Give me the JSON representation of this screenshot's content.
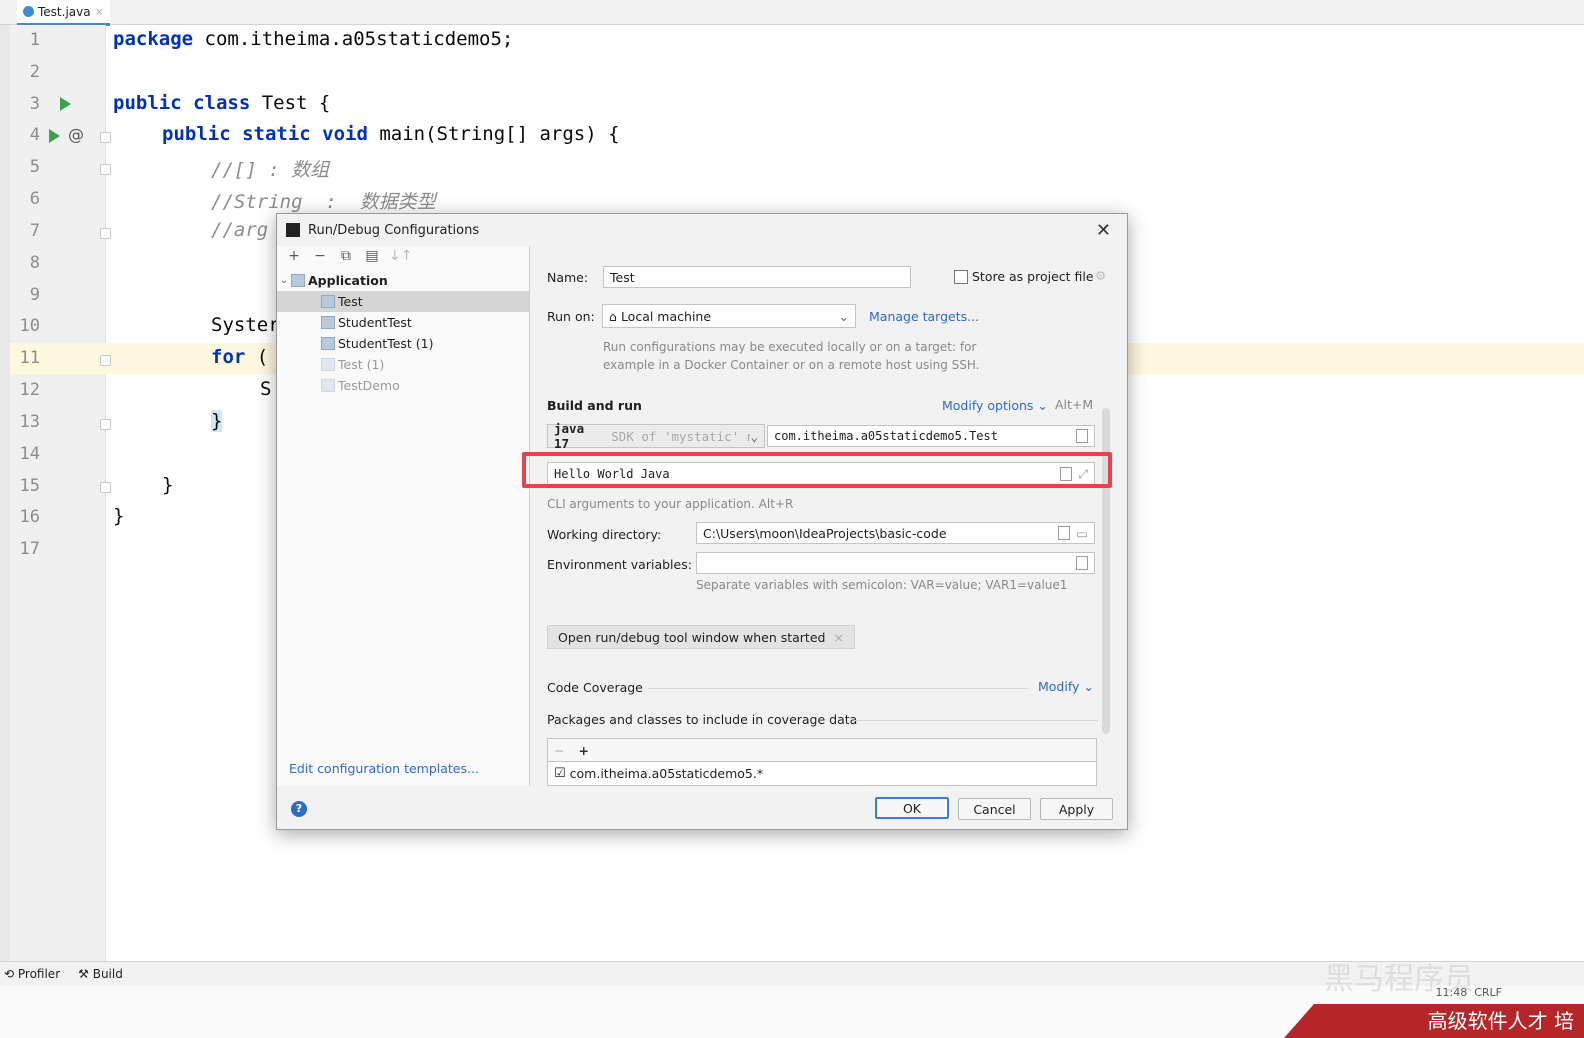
{
  "tabs": [
    {
      "label": "Test.java"
    }
  ],
  "editor": {
    "line_numbers": [
      "1",
      "2",
      "3",
      "4",
      "5",
      "6",
      "7",
      "8",
      "9",
      "10",
      "11",
      "12",
      "13",
      "14",
      "15",
      "16",
      "17"
    ],
    "lines": {
      "l1_kw": "package",
      "l1_rest": " com.itheima.a05staticdemo5;",
      "l3_kw": "public class",
      "l3_rest": " Test {",
      "l4_kw": "public static void",
      "l4_rest": " main(String[] args) {",
      "l5": "//[] : 数组",
      "l6": "//String  :  数据类型",
      "l7": "//arg",
      "l10": "Syster",
      "l11_kw": "for",
      "l11_rest": " (",
      "l12": "S",
      "l13": "}",
      "l15": "}",
      "l16": "}"
    },
    "gutter_markers": {
      "at_symbol": "@"
    }
  },
  "bottom_bar": {
    "profiler": "Profiler",
    "build": "Build"
  },
  "status": {
    "time": "11:48",
    "encoding": "CRLF"
  },
  "watermark": {
    "faded_text": "黑马程序员",
    "banner_text": "高级软件人才 培"
  },
  "dialog": {
    "title": "Run/Debug Configurations",
    "left_toolbar": [
      "+",
      "−",
      "⧉",
      "▤",
      "↓↑"
    ],
    "tree": {
      "group": "Application",
      "items": [
        {
          "label": "Test",
          "state": "selected"
        },
        {
          "label": "StudentTest",
          "state": "normal"
        },
        {
          "label": "StudentTest (1)",
          "state": "normal"
        },
        {
          "label": "Test (1)",
          "state": "dim"
        },
        {
          "label": "TestDemo",
          "state": "dim"
        }
      ]
    },
    "edit_templates_link": "Edit configuration templates...",
    "name_label": "Name:",
    "name_value": "Test",
    "store_label": "Store as project file",
    "run_on_label": "Run on:",
    "run_on_value": "Local machine",
    "manage_targets": "Manage targets...",
    "run_on_hint": "Run configurations may be executed locally or on a target: for\nexample in a Docker Container or on a remote host using SSH.",
    "build_run_title": "Build and run",
    "modify_options": "Modify options",
    "modify_shortcut": "Alt+M",
    "jdk_value": "java 17",
    "jdk_suffix": "SDK of 'mystatic' n",
    "main_class": "com.itheima.a05staticdemo5.Test",
    "program_args": "Hello World Java",
    "cli_hint": "CLI arguments to your application. Alt+R",
    "working_dir_label": "Working directory:",
    "working_dir_value": "C:\\Users\\moon\\IdeaProjects\\basic-code",
    "env_label": "Environment variables:",
    "env_value": "",
    "env_hint": "Separate variables with semicolon: VAR=value; VAR1=value1",
    "open_tool_window_chip": "Open run/debug tool window when started",
    "code_coverage_label": "Code Coverage",
    "coverage_modify": "Modify",
    "packages_label": "Packages and classes to include in coverage data",
    "coverage_toolbar": [
      "−",
      "+"
    ],
    "coverage_item": "com.itheima.a05staticdemo5.*",
    "buttons": {
      "ok": "OK",
      "cancel": "Cancel",
      "apply": "Apply"
    },
    "help_icon": "?"
  },
  "colors": {
    "accent": "#2f6ac7",
    "highlight_box": "#e8434a",
    "keyword": "#0033b3"
  }
}
